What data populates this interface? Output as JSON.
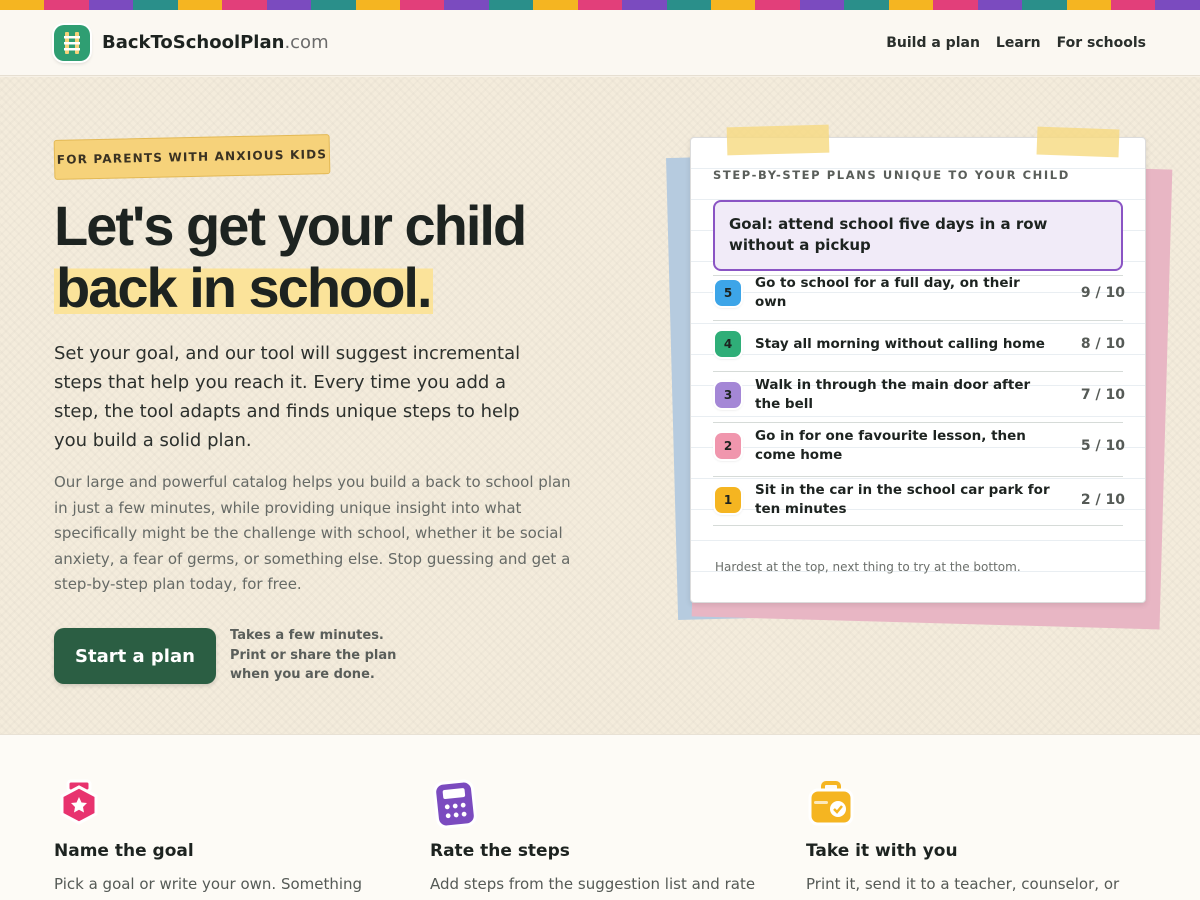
{
  "stripe_colors": [
    "#f5b521",
    "#e23f7a",
    "#7b4bbf",
    "#2a8f8a"
  ],
  "header": {
    "brand_main": "BackToSchoolPlan",
    "brand_tld": ".com",
    "nav": [
      "Build a plan",
      "Learn",
      "For schools"
    ]
  },
  "hero": {
    "pill": "FOR PARENTS WITH ANXIOUS KIDS",
    "title_line1": "Let's get your child",
    "title_line2": "back in school.",
    "lede": "Set your goal, and our tool will suggest incremental steps that help you reach it. Every time you add a step, the tool adapts and finds unique steps to help you build a solid plan.",
    "body": "Our large and powerful catalog helps you build a back to school plan in just a few minutes, while providing unique insight into what specifically might be the challenge with school, whether it be social anxiety, a fear of germs, or something else. Stop guessing and get a step-by-step plan today, for free.",
    "cta": "Start a plan",
    "cta_note": "Takes a few minutes. Print or share the plan when you are done."
  },
  "plan_card": {
    "label": "STEP-BY-STEP PLANS UNIQUE TO YOUR CHILD",
    "goal": "Goal: attend school five days in a row without a pickup",
    "steps": [
      {
        "num": "5",
        "text": "Go to school for a full day, on their own",
        "score": "9 / 10",
        "color": "#3da5e8",
        "textColor": "#1d2320"
      },
      {
        "num": "4",
        "text": "Stay all morning without calling home",
        "score": "8 / 10",
        "color": "#2fae78",
        "textColor": "#1d2320"
      },
      {
        "num": "3",
        "text": "Walk in through the main door after the bell",
        "score": "7 / 10",
        "color": "#a487d6",
        "textColor": "#1d2320"
      },
      {
        "num": "2",
        "text": "Go in for one favourite lesson, then come home",
        "score": "5 / 10",
        "color": "#f096ad",
        "textColor": "#1d2320"
      },
      {
        "num": "1",
        "text": "Sit in the car in the school car park for ten minutes",
        "score": "2 / 10",
        "color": "#f5b521",
        "textColor": "#1d2320"
      }
    ],
    "footer": "Hardest at the top, next thing to try at the bottom."
  },
  "features": [
    {
      "title": "Name the goal",
      "text": "Pick a goal or write your own. Something specific",
      "icon": "star-badge-icon",
      "color": "#e8336f"
    },
    {
      "title": "Rate the steps",
      "text": "Add steps from the suggestion list and rate each",
      "icon": "calculator-icon",
      "color": "#7b4bbf"
    },
    {
      "title": "Take it with you",
      "text": "Print it, send it to a teacher, counselor, or",
      "icon": "briefcase-check-icon",
      "color": "#f5b521"
    }
  ]
}
